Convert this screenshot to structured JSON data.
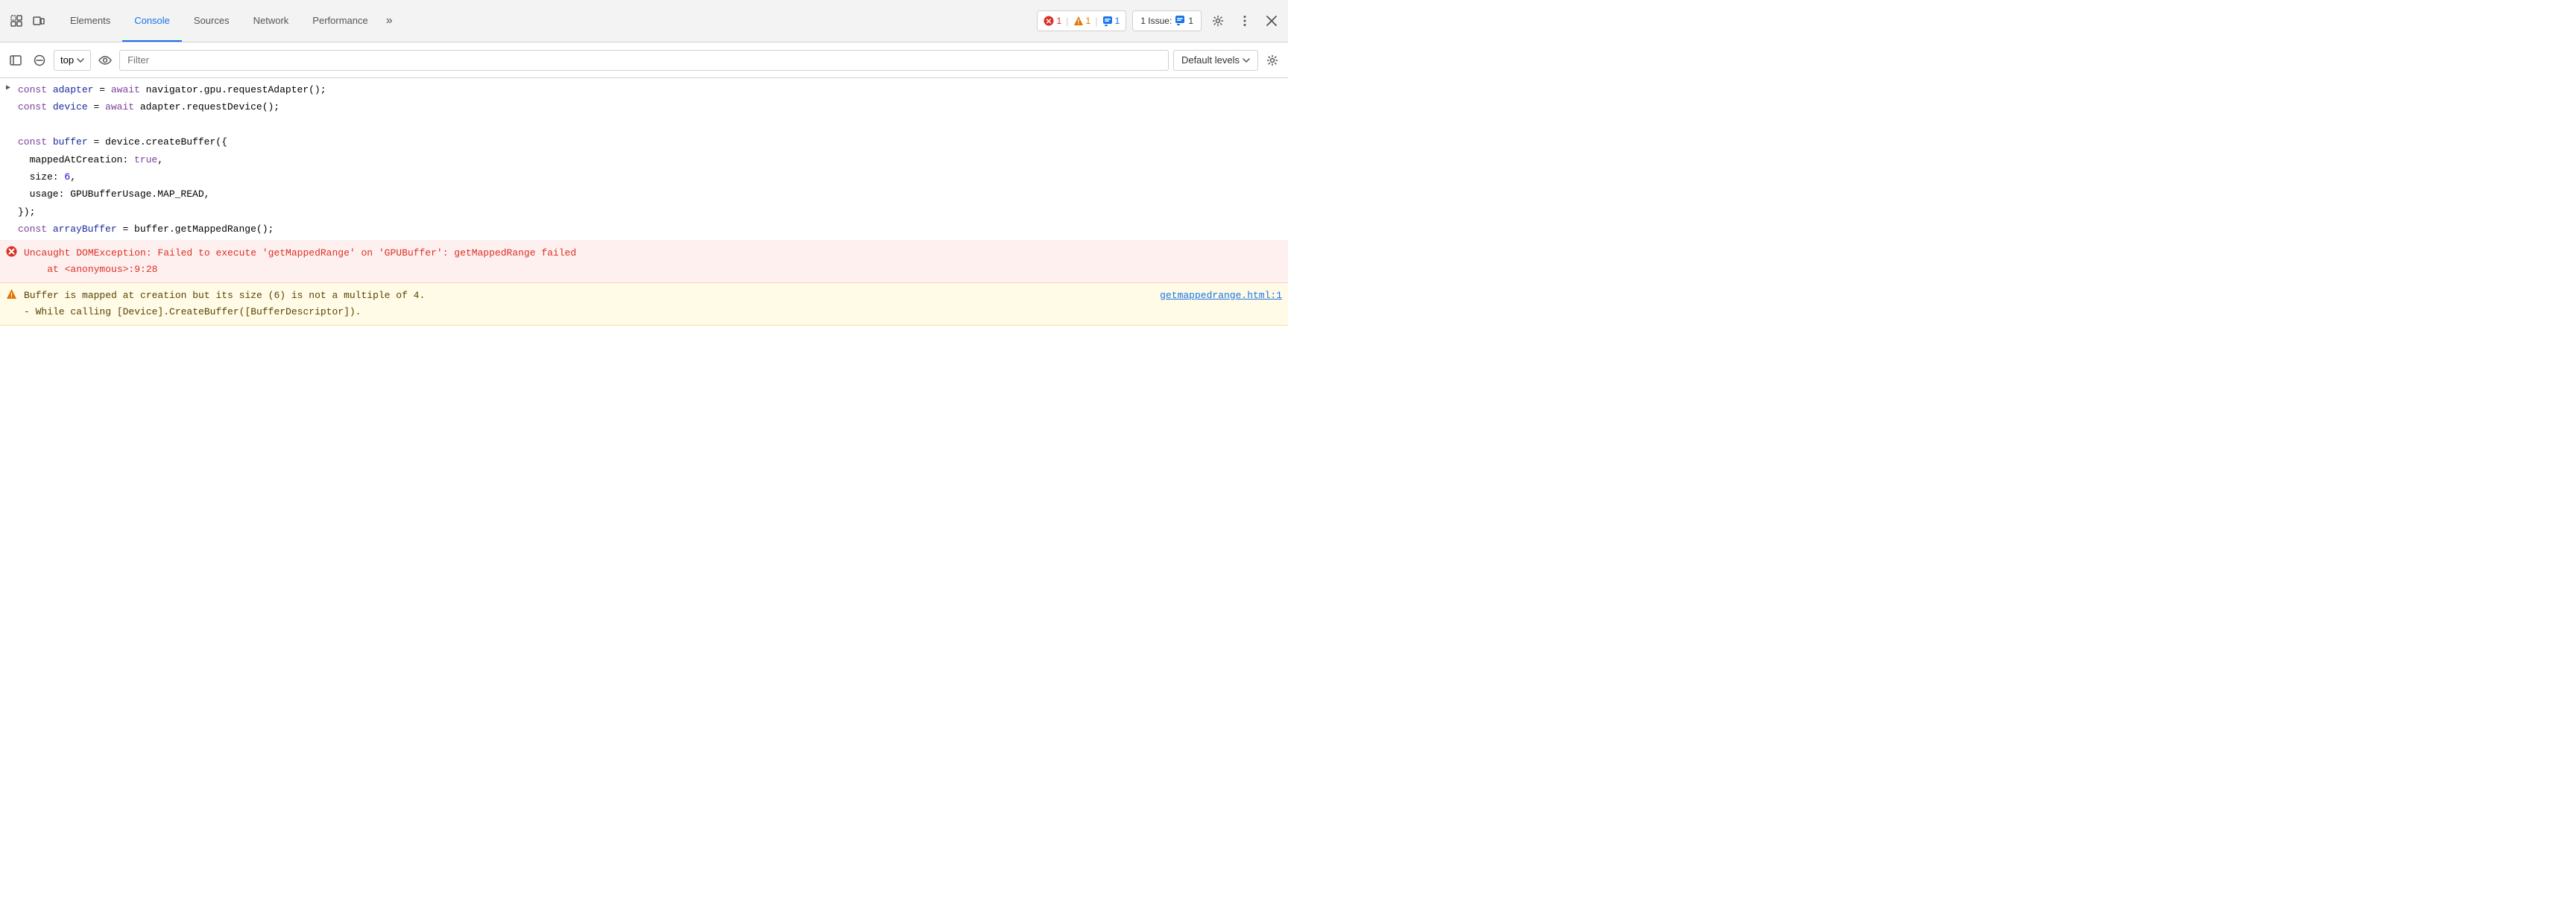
{
  "toolbar": {
    "tabs": [
      {
        "id": "elements",
        "label": "Elements",
        "active": false
      },
      {
        "id": "console",
        "label": "Console",
        "active": true
      },
      {
        "id": "sources",
        "label": "Sources",
        "active": false
      },
      {
        "id": "network",
        "label": "Network",
        "active": false
      },
      {
        "id": "performance",
        "label": "Performance",
        "active": false
      }
    ],
    "more_label": "»",
    "error_count": "1",
    "warning_count": "1",
    "info_count": "1",
    "issues_label": "1 Issue:",
    "issues_count": "1"
  },
  "console_toolbar": {
    "top_label": "top",
    "filter_placeholder": "Filter",
    "default_levels_label": "Default levels"
  },
  "console": {
    "code_lines": [
      {
        "has_arrow": true,
        "html": "<span class='kw-const'>const</span> <span class='kw-var-name'>adapter</span> <span class='kw-plain'>= </span><span class='kw-await'>await</span> <span class='kw-plain'>navigator.gpu.requestAdapter();</span>"
      },
      {
        "has_arrow": false,
        "html": "<span class='kw-const'>const</span> <span class='kw-var-name'>device</span> <span class='kw-plain'>= </span><span class='kw-await'>await</span> <span class='kw-plain'>adapter.requestDevice();</span>"
      },
      {
        "has_arrow": false,
        "html": ""
      },
      {
        "has_arrow": false,
        "html": "<span class='kw-const'>const</span> <span class='kw-var-name'>buffer</span> <span class='kw-plain'>= device.createBuffer({</span>"
      },
      {
        "has_arrow": false,
        "html": "<span class='kw-plain'>&nbsp;&nbsp;mappedAtCreation: </span><span class='kw-true'>true</span><span class='kw-plain'>,</span>"
      },
      {
        "has_arrow": false,
        "html": "<span class='kw-plain'>&nbsp;&nbsp;size: </span><span class='kw-number'>6</span><span class='kw-plain'>,</span>"
      },
      {
        "has_arrow": false,
        "html": "<span class='kw-plain'>&nbsp;&nbsp;usage: GPUBufferUsage.MAP_READ,</span>"
      },
      {
        "has_arrow": false,
        "html": "<span class='kw-plain'>});</span>"
      },
      {
        "has_arrow": false,
        "html": "<span class='kw-const'>const</span> <span class='kw-var-name'>arrayBuffer</span> <span class='kw-plain'>= buffer.getMappedRange();</span>"
      }
    ],
    "error_icon": "✖",
    "error_text": "Uncaught DOMException: Failed to execute 'getMappedRange' on 'GPUBuffer': getMappedRange failed",
    "error_location": "at <anonymous>:9:28",
    "warning_icon": "⚠",
    "warning_text_line1": "Buffer is mapped at creation but its size (6) is not a multiple of 4.",
    "warning_text_line2": "  - While calling [Device].CreateBuffer([BufferDescriptor]).",
    "warning_link": "getmappedrange.html:1"
  }
}
